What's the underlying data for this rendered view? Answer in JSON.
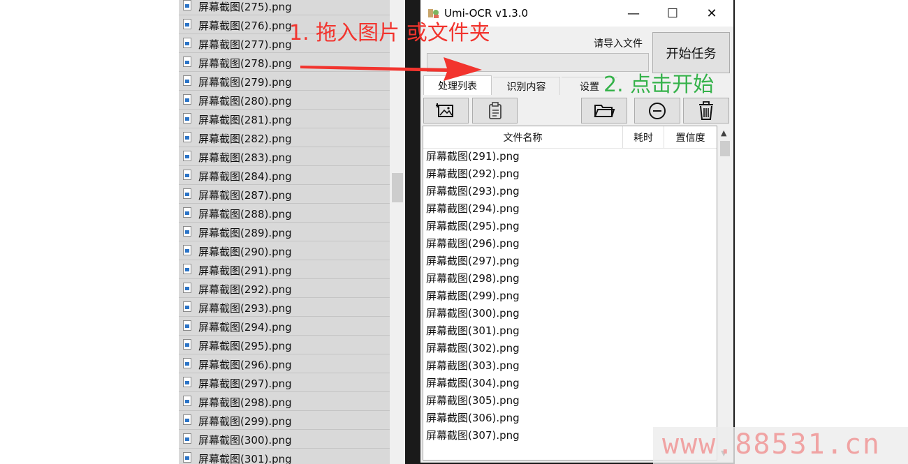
{
  "explorer": {
    "files": [
      "屏幕截图(275).png",
      "屏幕截图(276).png",
      "屏幕截图(277).png",
      "屏幕截图(278).png",
      "屏幕截图(279).png",
      "屏幕截图(280).png",
      "屏幕截图(281).png",
      "屏幕截图(282).png",
      "屏幕截图(283).png",
      "屏幕截图(284).png",
      "屏幕截图(287).png",
      "屏幕截图(288).png",
      "屏幕截图(289).png",
      "屏幕截图(290).png",
      "屏幕截图(291).png",
      "屏幕截图(292).png",
      "屏幕截图(293).png",
      "屏幕截图(294).png",
      "屏幕截图(295).png",
      "屏幕截图(296).png",
      "屏幕截图(297).png",
      "屏幕截图(298).png",
      "屏幕截图(299).png",
      "屏幕截图(300).png",
      "屏幕截图(301).png"
    ]
  },
  "app": {
    "title": "Umi-OCR v1.3.0",
    "window_controls": {
      "minimize": "—",
      "maximize": "☐",
      "close": "✕"
    },
    "import_label": "请导入文件",
    "start_button": "开始任务",
    "tabs": [
      "处理列表",
      "识别内容",
      "设置"
    ],
    "toolbar_icons": [
      "add-image-icon",
      "paste-icon",
      "folder-open-icon",
      "remove-icon",
      "trash-icon"
    ],
    "table": {
      "columns": [
        "文件名称",
        "耗时",
        "置信度"
      ],
      "rows": [
        "屏幕截图(291).png",
        "屏幕截图(292).png",
        "屏幕截图(293).png",
        "屏幕截图(294).png",
        "屏幕截图(295).png",
        "屏幕截图(296).png",
        "屏幕截图(297).png",
        "屏幕截图(298).png",
        "屏幕截图(299).png",
        "屏幕截图(300).png",
        "屏幕截图(301).png",
        "屏幕截图(302).png",
        "屏幕截图(303).png",
        "屏幕截图(304).png",
        "屏幕截图(305).png",
        "屏幕截图(306).png",
        "屏幕截图(307).png"
      ]
    }
  },
  "annotations": {
    "step1": "1. 拖入图片 或文件夹",
    "step2": "2. 点击开始",
    "step1_color": "#f2342e",
    "step2_color": "#35b24a"
  },
  "watermark": "www.88531.cn"
}
